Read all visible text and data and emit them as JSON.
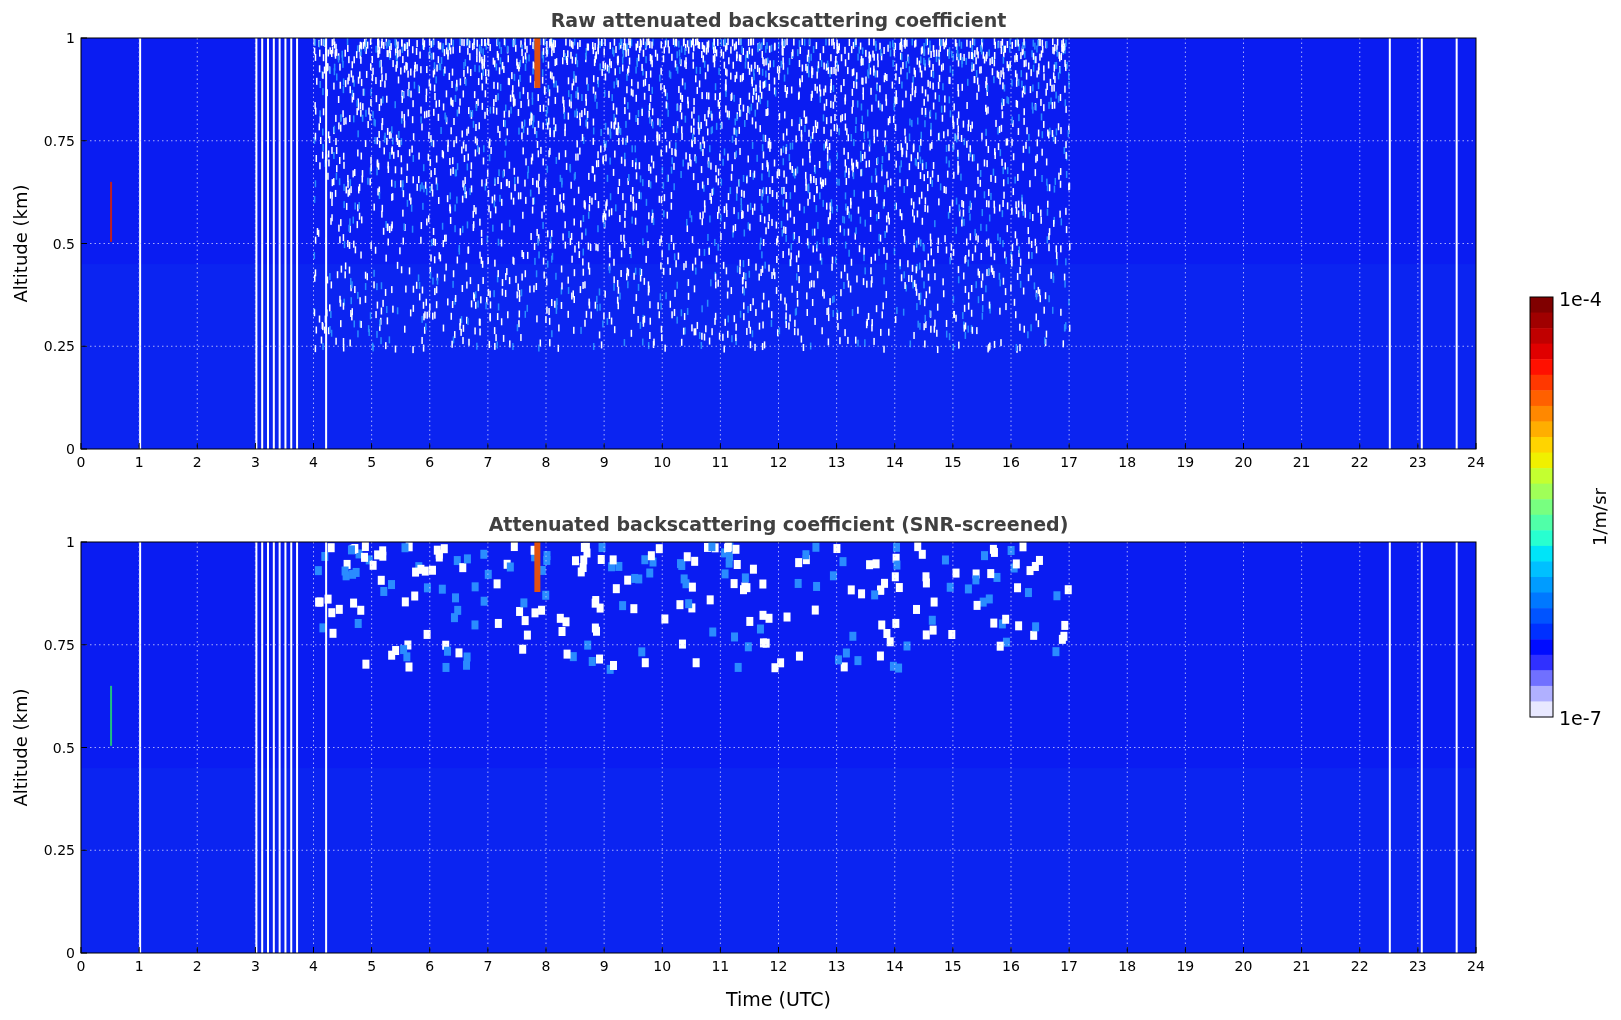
{
  "panels": [
    {
      "title": "Raw attenuated backscattering coefficient",
      "ylabel": "Altitude (km)",
      "yticks": [
        "1",
        "0.75",
        "0.5",
        "0.25",
        "0"
      ],
      "xticks": [
        "0",
        "1",
        "2",
        "3",
        "4",
        "5",
        "6",
        "7",
        "8",
        "9",
        "10",
        "11",
        "12",
        "13",
        "14",
        "15",
        "16",
        "17",
        "18",
        "19",
        "20",
        "21",
        "22",
        "23",
        "24"
      ],
      "kind": "raw"
    },
    {
      "title": "Attenuated backscattering coefficient (SNR-screened)",
      "ylabel": "Altitude (km)",
      "yticks": [
        "1",
        "0.75",
        "0.5",
        "0.25",
        "0"
      ],
      "xticks": [
        "0",
        "1",
        "2",
        "3",
        "4",
        "5",
        "6",
        "7",
        "8",
        "9",
        "10",
        "11",
        "12",
        "13",
        "14",
        "15",
        "16",
        "17",
        "18",
        "19",
        "20",
        "21",
        "22",
        "23",
        "24"
      ],
      "kind": "screened"
    }
  ],
  "xlabel": "Time (UTC)",
  "colorbar": {
    "max_label": "1e-4",
    "min_label": "1e-7",
    "unit": "1/m/sr"
  }
}
